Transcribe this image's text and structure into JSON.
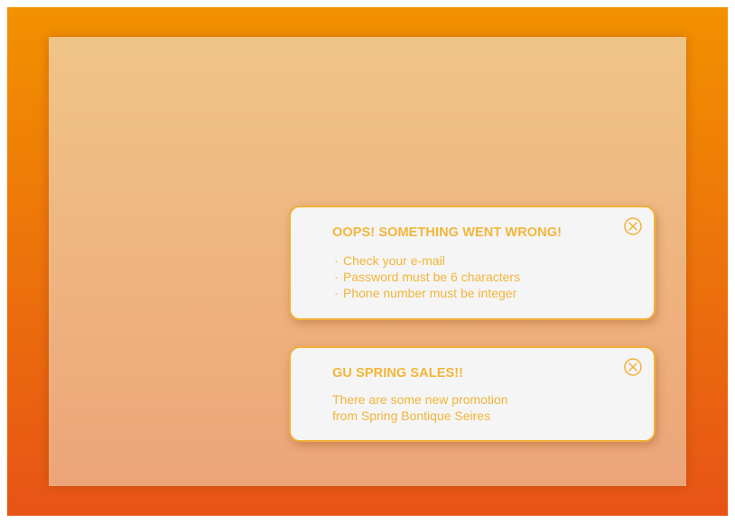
{
  "colors": {
    "frame_top": "#f29100",
    "frame_bottom": "#e75416",
    "panel_top": "#f0c488",
    "panel_bottom": "#eca579",
    "toast_bg": "#f5f5f5",
    "toast_border": "#f1b13a",
    "accent_text": "#f3b53a"
  },
  "notifications": [
    {
      "title": "OOPS! SOMETHING WENT WRONG!",
      "items": [
        "Check your e-mail",
        "Password must be 6 characters",
        "Phone number must be integer"
      ],
      "bullet": "·",
      "close_icon": "close-circle-icon"
    },
    {
      "title": "GU SPRING SALES!!",
      "body_lines": [
        "There are some new promotion",
        "from Spring Bontique Seires"
      ],
      "close_icon": "close-circle-icon"
    }
  ]
}
